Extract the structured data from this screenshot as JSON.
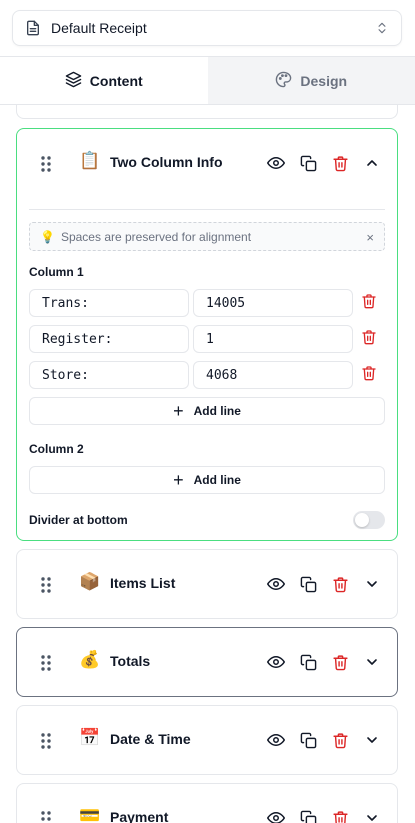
{
  "receipt_select": {
    "value": "Default Receipt"
  },
  "tabs": [
    {
      "label": "Content",
      "active": true
    },
    {
      "label": "Design",
      "active": false
    }
  ],
  "expanded_block": {
    "emoji": "📋",
    "title": "Two Column Info",
    "hint": "Spaces are preserved for alignment",
    "hint_icon": "💡",
    "hint_close": "×",
    "column1_label": "Column 1",
    "column1_rows": [
      {
        "left": "Trans:",
        "right": "14005"
      },
      {
        "left": "Register:",
        "right": "1"
      },
      {
        "left": "Store:",
        "right": "4068"
      }
    ],
    "add_line_label": "Add line",
    "column2_label": "Column 2",
    "divider_label": "Divider at bottom",
    "divider_enabled": false
  },
  "blocks": [
    {
      "emoji": "📦",
      "title": "Items List"
    },
    {
      "emoji": "💰",
      "title": "Totals"
    },
    {
      "emoji": "📅",
      "title": "Date & Time"
    },
    {
      "emoji": "💳",
      "title": "Payment"
    }
  ],
  "colors": {
    "accent_border": "#4ade80",
    "delete_red": "#dc2626",
    "muted": "#6b7280"
  }
}
